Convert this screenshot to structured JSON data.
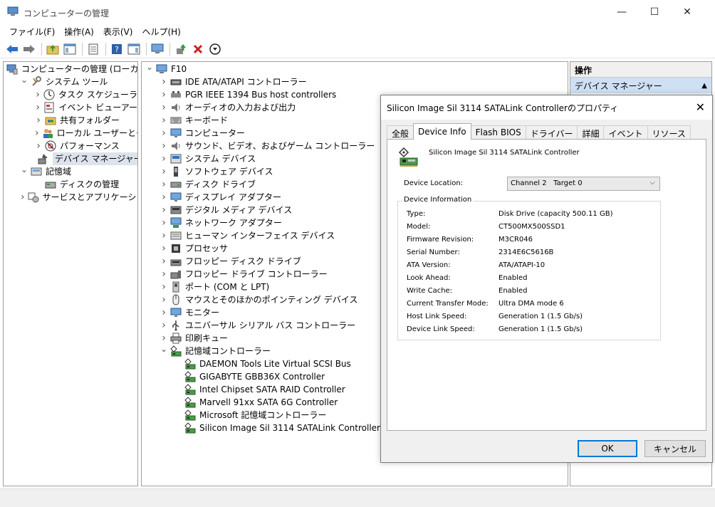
{
  "window": {
    "title": "コンピューターの管理",
    "minimize": "—",
    "maximize": "☐",
    "close": "✕"
  },
  "menu": [
    "ファイル(F)",
    "操作(A)",
    "表示(V)",
    "ヘルプ(H)"
  ],
  "left_tree": [
    {
      "label": "コンピューターの管理 (ローカル)",
      "indent": 0,
      "chev": "",
      "icon": "computer-management-icon"
    },
    {
      "label": "システム ツール",
      "indent": 1,
      "chev": "down",
      "icon": "system-tools-icon"
    },
    {
      "label": "タスク スケジューラ",
      "indent": 2,
      "chev": "right",
      "icon": "clock-icon"
    },
    {
      "label": "イベント ビューアー",
      "indent": 2,
      "chev": "right",
      "icon": "event-viewer-icon"
    },
    {
      "label": "共有フォルダー",
      "indent": 2,
      "chev": "right",
      "icon": "shared-folder-icon"
    },
    {
      "label": "ローカル ユーザーとグループ",
      "indent": 2,
      "chev": "right",
      "icon": "users-icon"
    },
    {
      "label": "パフォーマンス",
      "indent": 2,
      "chev": "right",
      "icon": "performance-icon"
    },
    {
      "label": "デバイス マネージャー",
      "indent": 2,
      "chev": "",
      "icon": "device-manager-icon",
      "selected": true
    },
    {
      "label": "記憶域",
      "indent": 1,
      "chev": "down",
      "icon": "storage-icon"
    },
    {
      "label": "ディスクの管理",
      "indent": 2,
      "chev": "",
      "icon": "disk-management-icon"
    },
    {
      "label": "サービスとアプリケーション",
      "indent": 1,
      "chev": "right",
      "icon": "services-icon"
    }
  ],
  "device_tree": [
    {
      "label": "F10",
      "indent": 0,
      "chev": "down",
      "icon": "computer-icon"
    },
    {
      "label": "IDE ATA/ATAPI コントローラー",
      "indent": 1,
      "chev": "right",
      "icon": "ide-controller-icon"
    },
    {
      "label": "PGR IEEE 1394 Bus host controllers",
      "indent": 1,
      "chev": "right",
      "icon": "firewire-icon"
    },
    {
      "label": "オーディオの入力および出力",
      "indent": 1,
      "chev": "right",
      "icon": "speaker-icon"
    },
    {
      "label": "キーボード",
      "indent": 1,
      "chev": "right",
      "icon": "keyboard-icon"
    },
    {
      "label": "コンピューター",
      "indent": 1,
      "chev": "right",
      "icon": "monitor-icon"
    },
    {
      "label": "サウンド、ビデオ、およびゲーム コントローラー",
      "indent": 1,
      "chev": "right",
      "icon": "speaker-icon"
    },
    {
      "label": "システム デバイス",
      "indent": 1,
      "chev": "right",
      "icon": "system-device-icon"
    },
    {
      "label": "ソフトウェア デバイス",
      "indent": 1,
      "chev": "right",
      "icon": "software-device-icon"
    },
    {
      "label": "ディスク ドライブ",
      "indent": 1,
      "chev": "right",
      "icon": "disk-drive-icon"
    },
    {
      "label": "ディスプレイ アダプター",
      "indent": 1,
      "chev": "right",
      "icon": "monitor-icon"
    },
    {
      "label": "デジタル メディア デバイス",
      "indent": 1,
      "chev": "right",
      "icon": "media-device-icon"
    },
    {
      "label": "ネットワーク アダプター",
      "indent": 1,
      "chev": "right",
      "icon": "network-icon"
    },
    {
      "label": "ヒューマン インターフェイス デバイス",
      "indent": 1,
      "chev": "right",
      "icon": "hid-icon"
    },
    {
      "label": "プロセッサ",
      "indent": 1,
      "chev": "right",
      "icon": "processor-icon"
    },
    {
      "label": "フロッピー ディスク ドライブ",
      "indent": 1,
      "chev": "right",
      "icon": "floppy-icon"
    },
    {
      "label": "フロッピー ドライブ コントローラー",
      "indent": 1,
      "chev": "right",
      "icon": "floppy-controller-icon"
    },
    {
      "label": "ポート (COM と LPT)",
      "indent": 1,
      "chev": "right",
      "icon": "port-icon"
    },
    {
      "label": "マウスとそのほかのポインティング デバイス",
      "indent": 1,
      "chev": "right",
      "icon": "mouse-icon"
    },
    {
      "label": "モニター",
      "indent": 1,
      "chev": "right",
      "icon": "monitor-icon"
    },
    {
      "label": "ユニバーサル シリアル バス コントローラー",
      "indent": 1,
      "chev": "right",
      "icon": "usb-icon"
    },
    {
      "label": "印刷キュー",
      "indent": 1,
      "chev": "right",
      "icon": "printer-icon"
    },
    {
      "label": "記憶域コントローラー",
      "indent": 1,
      "chev": "down",
      "icon": "storage-controller-icon"
    },
    {
      "label": "DAEMON Tools Lite Virtual SCSI Bus",
      "indent": 2,
      "chev": "",
      "icon": "storage-controller-icon"
    },
    {
      "label": "GIGABYTE GBB36X Controller",
      "indent": 2,
      "chev": "",
      "icon": "storage-controller-icon"
    },
    {
      "label": "Intel Chipset SATA RAID Controller",
      "indent": 2,
      "chev": "",
      "icon": "storage-controller-icon"
    },
    {
      "label": "Marvell 91xx SATA 6G Controller",
      "indent": 2,
      "chev": "",
      "icon": "storage-controller-icon"
    },
    {
      "label": "Microsoft 記憶域コントローラー",
      "indent": 2,
      "chev": "",
      "icon": "storage-controller-icon"
    },
    {
      "label": "Silicon Image Sil 3114 SATALink Controller",
      "indent": 2,
      "chev": "",
      "icon": "storage-controller-icon"
    }
  ],
  "actions": {
    "header": "操作",
    "item": "デバイス マネージャー",
    "item_arrow": "▲"
  },
  "dialog": {
    "title": "Silicon Image Sil 3114 SATALink Controllerのプロパティ",
    "close": "✕",
    "tabs": [
      {
        "label": "全般",
        "active": false
      },
      {
        "label": "Device Info",
        "active": true
      },
      {
        "label": "Flash BIOS",
        "active": false
      },
      {
        "label": "ドライバー",
        "active": false
      },
      {
        "label": "詳細",
        "active": false
      },
      {
        "label": "イベント",
        "active": false
      },
      {
        "label": "リソース",
        "active": false
      }
    ],
    "device_name": "Silicon Image Sil 3114 SATALink Controller",
    "location_label": "Device Location:",
    "location_value": "Channel 2   Target 0",
    "location_arrow": "⌵",
    "group_title": "Device Information",
    "info": [
      {
        "key": "Type:",
        "value": "Disk Drive (capacity 500.11 GB)"
      },
      {
        "key": "Model:",
        "value": "CT500MX500SSD1"
      },
      {
        "key": "Firmware Revision:",
        "value": "M3CR046"
      },
      {
        "key": "Serial Number:",
        "value": "2314E6C5616B"
      },
      {
        "key": "ATA Version:",
        "value": "ATA/ATAPI-10"
      },
      {
        "key": "Look Ahead:",
        "value": "Enabled"
      },
      {
        "key": "Write Cache:",
        "value": "Enabled"
      },
      {
        "key": "Current Transfer Mode:",
        "value": "Ultra DMA mode 6"
      },
      {
        "key": "Host Link Speed:",
        "value": "Generation 1 (1.5 Gb/s)"
      },
      {
        "key": "Device Link Speed:",
        "value": "Generation 1 (1.5 Gb/s)"
      }
    ],
    "ok": "OK",
    "cancel": "キャンセル"
  },
  "colors": {
    "selection": "#dde3ec",
    "action_item": "#cfe0f5",
    "accent": "#0078d7"
  }
}
